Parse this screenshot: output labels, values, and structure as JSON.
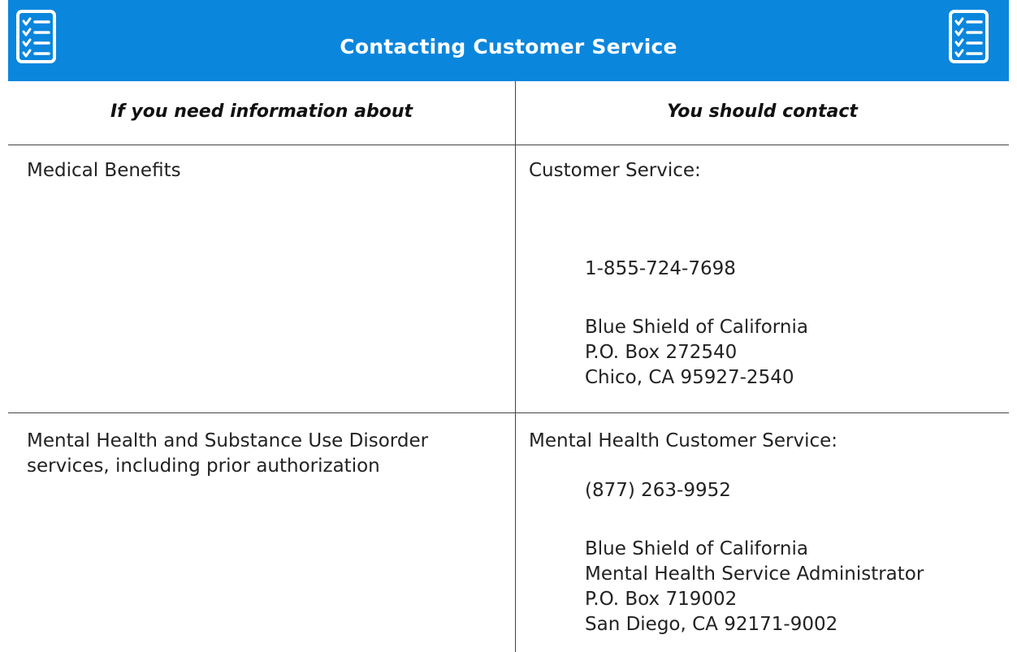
{
  "header": {
    "title": "Contacting Customer Service",
    "icon": "checklist-icon",
    "background": "#0a86dd"
  },
  "table": {
    "headers": [
      "If you need information about",
      "You should contact"
    ],
    "rows": [
      {
        "topic": "Medical Benefits",
        "contact_label": "Customer Service:",
        "phone": "1-855-724-7698",
        "address": [
          "Blue Shield of California",
          "P.O. Box 272540",
          "Chico, CA 95927-2540"
        ]
      },
      {
        "topic": "Mental Health and Substance Use Disorder services, including prior authorization",
        "contact_label": "Mental Health Customer Service:",
        "phone": "(877) 263-9952",
        "address": [
          "Blue Shield of California",
          "Mental Health Service Administrator",
          "P.O. Box 719002",
          "San Diego, CA 92171-9002"
        ]
      }
    ]
  }
}
